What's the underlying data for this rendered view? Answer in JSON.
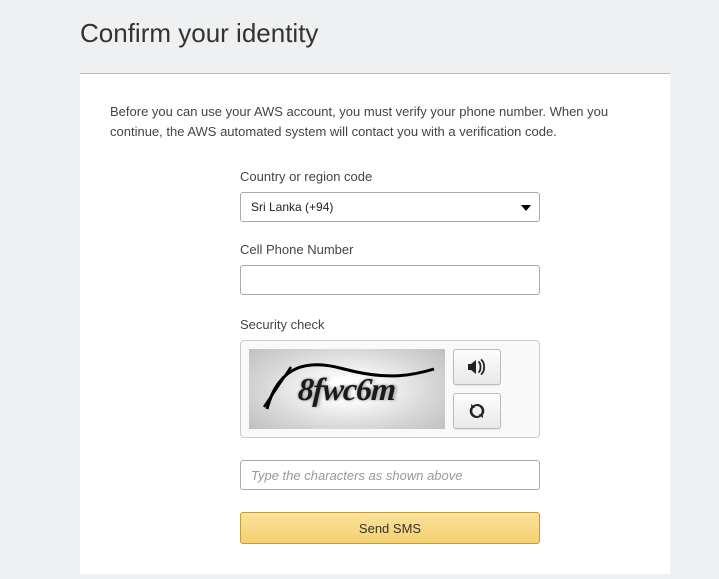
{
  "title": "Confirm your identity",
  "intro": "Before you can use your AWS account, you must verify your phone number. When you continue, the AWS automated system will contact you with a verification code.",
  "form": {
    "country_label": "Country or region code",
    "country_value": "Sri Lanka (+94)",
    "phone_label": "Cell Phone Number",
    "phone_value": "",
    "security_label": "Security check",
    "captcha_text": "8fwc6m",
    "captcha_input": "",
    "captcha_placeholder": "Type the characters as shown above",
    "submit_label": "Send SMS"
  }
}
